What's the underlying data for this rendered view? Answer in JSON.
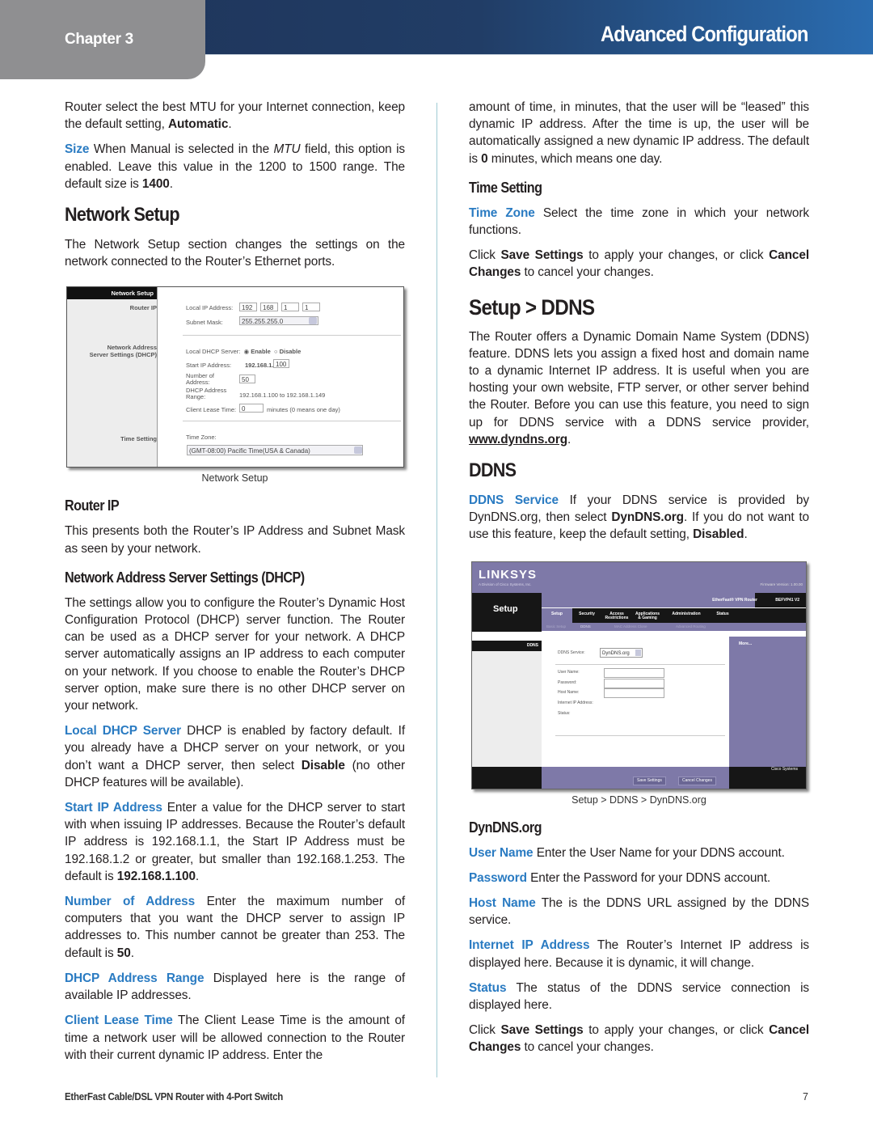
{
  "header": {
    "chapter": "Chapter 3",
    "title": "Advanced Configuration",
    "colors": {
      "bar_dark": "#1e3358",
      "bar_light": "#2a6cb0",
      "tab_gray": "#8f8f91",
      "term_blue": "#2a7bc2"
    }
  },
  "left": {
    "p_mtu_cont": {
      "pre": "Router select the best MTU for your Internet connection, keep the default setting, ",
      "bold": "Automatic",
      "post": "."
    },
    "p_size": {
      "term": "Size",
      "t1": " When Manual is selected in the ",
      "italic": "MTU",
      "t2": " field, this option is enabled. Leave this value in the 1200 to 1500 range. The default size is ",
      "bold": "1400",
      "post": "."
    },
    "h_network_setup": "Network Setup",
    "p_network_setup": "The Network Setup section changes the settings on the network connected to the Router’s Ethernet ports.",
    "screenshot": {
      "side_header": "Network Setup",
      "side_router_ip": "Router IP",
      "side_dhcp_1": "Network Address",
      "side_dhcp_2": "Server Settings (DHCP)",
      "side_time": "Time Setting",
      "local_ip_label": "Local IP Address:",
      "ip1": "192",
      "ip2": "168",
      "ip3": "1",
      "ip4": "1",
      "subnet_label": "Subnet Mask:",
      "subnet_value": "255.255.255.0",
      "dhcp_label": "Local DHCP Server:",
      "enable": "Enable",
      "disable": "Disable",
      "start_ip_label": "Start IP Address:",
      "start_ip_prefix": "192.168.1.",
      "start_ip_value": "100",
      "num_label_1": "Number  of",
      "num_label_2": "Address:",
      "num_value": "50",
      "range_label_1": "DHCP Address",
      "range_label_2": "Range:",
      "range_value": "192.168.1.100 to 192.168.1.149",
      "lease_label": "Client Lease Time:",
      "lease_value": "0",
      "lease_hint": "minutes (0 means one day)",
      "tz_label": "Time Zone:",
      "tz_value": "(GMT-08:00) Pacific Time(USA & Canada)"
    },
    "caption": "Network Setup",
    "h_router_ip": "Router IP",
    "p_router_ip": "This presents both the Router’s IP Address and Subnet Mask as seen by your network.",
    "h_dhcp": "Network Address Server Settings (DHCP)",
    "p_dhcp": "The settings allow you to configure the Router’s Dynamic Host Configuration Protocol (DHCP) server function. The Router can be used as a DHCP server for your network. A DHCP server automatically assigns an IP address to each computer on your network. If you choose to enable the Router’s DHCP server option, make sure there is no other DHCP server on your network.",
    "p_local_dhcp": {
      "term": "Local DHCP Server",
      "t1": " DHCP is enabled by factory default. If you already have a DHCP server on your network, or you don’t want a DHCP server, then select ",
      "bold": "Disable",
      "post": " (no other DHCP features will be available)."
    },
    "p_start_ip": {
      "term": "Start IP Address",
      "t1": " Enter a value for the DHCP server to start with when issuing IP addresses. Because the Router’s default IP address is 192.168.1.1, the Start IP Address must be 192.168.1.2 or greater, but smaller than 192.168.1.253. The default is ",
      "bold": "192.168.1.100",
      "post": "."
    },
    "p_num_addr": {
      "term": "Number of Address",
      "t1": " Enter the maximum number of computers that you want the DHCP server to assign IP addresses to. This number cannot be greater than 253. The default is ",
      "bold": "50",
      "post": "."
    },
    "p_range": {
      "term": "DHCP Address Range",
      "t1": " Displayed here is the range of available IP addresses."
    },
    "p_lease": {
      "term": "Client Lease Time",
      "t1": " The Client Lease Time is the amount of time a network user will be allowed connection to the Router with their current dynamic IP address. Enter the"
    }
  },
  "right": {
    "p_lease_cont": {
      "pre": "amount of time, in minutes, that the user will be “leased” this dynamic IP address. After the time is up, the user will be automatically assigned a new dynamic IP address. The default is ",
      "bold": "0",
      "post": " minutes, which means one day."
    },
    "h_time": "Time Setting",
    "p_tz": {
      "term": "Time Zone",
      "t1": " Select the time zone in which your network functions."
    },
    "p_save1": {
      "pre": "Click ",
      "b1": "Save Settings",
      "mid": " to apply your changes, or click ",
      "b2": "Cancel Changes",
      "post": " to cancel your changes."
    },
    "h_setup_ddns": "Setup > DDNS",
    "p_ddns_intro": {
      "pre": "The Router offers a Dynamic Domain Name System (DDNS) feature. DDNS lets you assign a fixed host and domain name to a dynamic Internet IP address. It is useful when you are hosting your own website, FTP server, or other server behind the Router.  Before you can use this feature, you need to sign up for DDNS service with a DDNS service provider, ",
      "link": "www.dyndns.org",
      "post": "."
    },
    "h_ddns": "DDNS",
    "p_ddns_service": {
      "term": "DDNS Service",
      "t1": " If your DDNS service is provided by DynDNS.org, then select ",
      "bold": "DynDNS.org",
      "t2": ". If you do not want to use this feature, keep the default setting, ",
      "bold2": "Disabled",
      "post": "."
    },
    "screenshot": {
      "logo": "LINKSYS",
      "logo_sub": "A Division of Cisco Systems, Inc.",
      "firmware": "Firmware Version: 1.00.00",
      "section": "Setup",
      "product": "EtherFast® VPN Router",
      "model": "BEFVP41 V2",
      "tabs": [
        "Setup",
        "Security",
        "Access Restrictions",
        "Applications & Gaming",
        "Administration",
        "Status"
      ],
      "subtabs": [
        "Basic Setup",
        "DDNS",
        "MAC Address Clone",
        "Advanced Routing"
      ],
      "ddns_header": "DDNS",
      "more": "More...",
      "service_label": "DDNS Service:",
      "service_value": "DynDNS.org",
      "user_label": "User Name:",
      "password_label": "Password:",
      "host_label": "Host Name:",
      "ip_label": "Internet IP Address:",
      "status_label": "Status:",
      "save_btn": "Save Settings",
      "cancel_btn": "Cancel Changes",
      "cisco": "Cisco Systems",
      "purple": "#7e79a8"
    },
    "caption": "Setup > DDNS > DynDNS.org",
    "h_dyndns": "DynDNS.org",
    "p_user": {
      "term": "User Name",
      "t1": " Enter the User Name for your DDNS account."
    },
    "p_pass": {
      "term": "Password",
      "t1": " Enter the Password for your DDNS account."
    },
    "p_host": {
      "term": "Host Name",
      "t1": " The is the DDNS URL assigned by the DDNS service."
    },
    "p_inet": {
      "term": "Internet IP Address",
      "t1": " The Router’s Internet IP address is displayed here. Because it is dynamic, it will change."
    },
    "p_status": {
      "term": "Status",
      "t1": " The status of the DDNS service connection is displayed here."
    },
    "p_save2": {
      "pre": "Click ",
      "b1": "Save Settings",
      "mid": " to apply your changes, or click ",
      "b2": "Cancel Changes",
      "post": " to cancel your changes."
    }
  },
  "footer": {
    "product": "EtherFast Cable/DSL VPN Router with 4-Port Switch",
    "page": "7"
  }
}
